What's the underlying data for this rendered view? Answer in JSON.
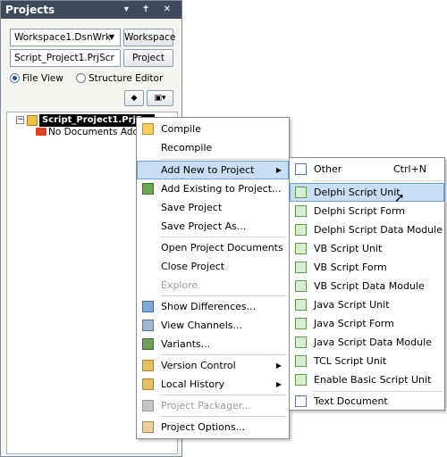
{
  "panel": {
    "title": "Projects",
    "title_icons": "▾ ✝ ✕",
    "workspace_value": "Workspace1.DsnWrk",
    "workspace_button": "Workspace",
    "project_value": "Script_Project1.PrjScr",
    "project_button": "Project",
    "radio_file_view": "File View",
    "radio_structure_editor": "Structure Editor",
    "selected_view": "File View"
  },
  "tree": {
    "project_name": "Script_Project1.PrjScr",
    "no_documents": "No Documents Added"
  },
  "context_menu": {
    "items": [
      {
        "label": "Compile"
      },
      {
        "label": "Recompile"
      },
      {
        "label": "Add New to Project"
      },
      {
        "label": "Add Existing to Project..."
      },
      {
        "label": "Save Project"
      },
      {
        "label": "Save Project As..."
      },
      {
        "label": "Open Project Documents"
      },
      {
        "label": "Close Project"
      },
      {
        "label": "Explore"
      },
      {
        "label": "Show Differences..."
      },
      {
        "label": "View Channels..."
      },
      {
        "label": "Variants..."
      },
      {
        "label": "Version Control"
      },
      {
        "label": "Local History"
      },
      {
        "label": "Project Packager..."
      },
      {
        "label": "Project Options..."
      }
    ]
  },
  "submenu": {
    "items": [
      {
        "label": "Other",
        "shortcut": "Ctrl+N"
      },
      {
        "label": "Delphi Script Unit"
      },
      {
        "label": "Delphi Script Form"
      },
      {
        "label": "Delphi Script Data Module"
      },
      {
        "label": "VB Script Unit"
      },
      {
        "label": "VB Script Form"
      },
      {
        "label": "VB Script Data Module"
      },
      {
        "label": "Java Script Unit"
      },
      {
        "label": "Java Script Form"
      },
      {
        "label": "Java Script Data Module"
      },
      {
        "label": "TCL Script Unit"
      },
      {
        "label": "Enable Basic Script Unit"
      },
      {
        "label": "Text Document"
      }
    ]
  },
  "colors": {
    "titlebar": "#3e4a59",
    "highlight": "#c9def5",
    "highlight_border": "#6ea0d6",
    "disabled_text": "#9a9a9a"
  }
}
